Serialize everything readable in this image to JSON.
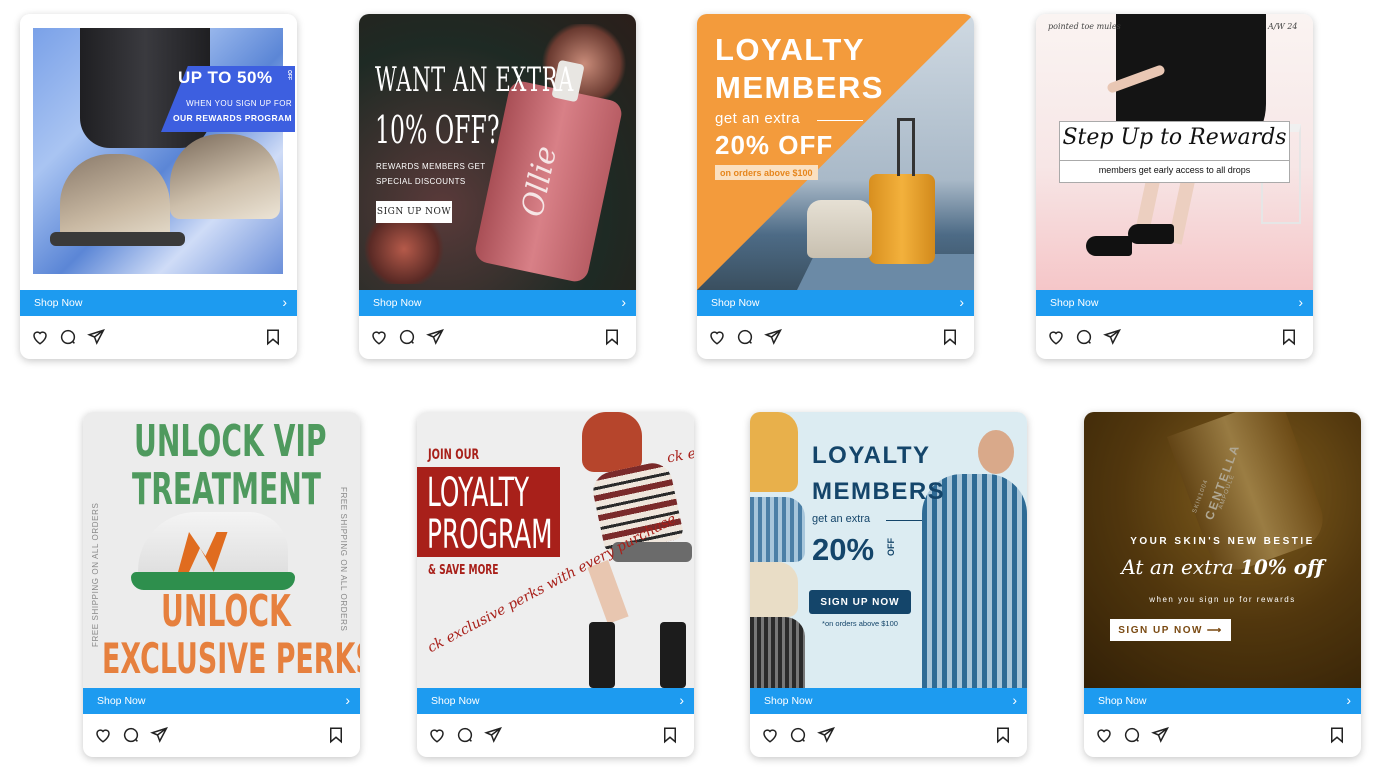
{
  "colors": {
    "shop_bar": "#1d9bf0",
    "icon": "#222222"
  },
  "icons": {
    "like": "heart-icon",
    "comment": "comment-icon",
    "share": "send-icon",
    "save": "bookmark-icon",
    "chevron": "chevron-right-icon"
  },
  "cards": [
    {
      "headline": "UP TO 50%",
      "headline_suffix": "OFF",
      "line1": "WHEN YOU SIGN UP FOR",
      "line2": "OUR REWARDS PROGRAM",
      "shop_label": "Shop Now"
    },
    {
      "headline1": "WANT AN EXTRA",
      "headline2": "10% OFF?",
      "line1": "REWARDS MEMBERS GET",
      "line2": "SPECIAL DISCOUNTS",
      "button": "SIGN UP NOW",
      "bottle_brand": "Ollie",
      "shop_label": "Shop Now"
    },
    {
      "headline1": "LOYALTY",
      "headline2": "MEMBERS",
      "line1": "get an extra",
      "offer": "20% OFF",
      "note": "on orders above $100",
      "shop_label": "Shop Now"
    },
    {
      "corner_left": "pointed toe mules",
      "corner_right": "A/W 24",
      "headline": "Step Up to Rewards",
      "sub": "members get early access to all drops",
      "shop_label": "Shop Now"
    },
    {
      "headline1": "UNLOCK VIP",
      "headline2": "TREATMENT",
      "side_text": "FREE SHIPPING ON ALL ORDERS",
      "headline3": "UNLOCK",
      "headline4": "EXCLUSIVE PERKS",
      "shop_label": "Shop Now"
    },
    {
      "pre": "JOIN OUR",
      "headline1": "LOYALTY",
      "headline2": "PROGRAM",
      "post": "& SAVE MORE",
      "curve_text": "ck exclusive perks with every purchase",
      "curve_text_top": "ck e",
      "shop_label": "Shop Now"
    },
    {
      "headline1": "LOYALTY",
      "headline2": "MEMBERS",
      "line1": "get an extra",
      "offer": "20%",
      "offer_suffix": "OFF",
      "button": "SIGN UP NOW",
      "note": "*on orders above $100",
      "shop_label": "Shop Now"
    },
    {
      "pre": "YOUR SKIN'S NEW BESTIE",
      "headline": "At an extra",
      "highlight": "10% off",
      "line1": "when you sign up for rewards",
      "button": "SIGN UP NOW",
      "label_brand": "CENTELLA",
      "label_top": "SKIN1004",
      "label_sub": "AMPOULE",
      "shop_label": "Shop Now"
    }
  ]
}
